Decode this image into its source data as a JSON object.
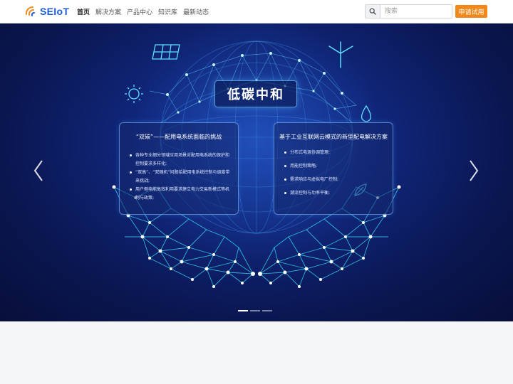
{
  "header": {
    "logo_text": "SEIoT",
    "nav": [
      {
        "label": "首页",
        "active": true
      },
      {
        "label": "解决方案",
        "active": false
      },
      {
        "label": "产品中心",
        "active": false
      },
      {
        "label": "知识库",
        "active": false
      },
      {
        "label": "最新动态",
        "active": false
      }
    ],
    "search": {
      "placeholder": "搜索",
      "value": ""
    },
    "cta_label": "申请试用"
  },
  "hero": {
    "headline": "低碳中和",
    "left_panel": {
      "title": "“双碳”——配用电系统面临的挑战",
      "items": [
        "各种专业细分领域应用场景对配用电系统的保护和控制要求多样化;",
        "“双高”、“双随机”问题给配用电系统控制与调度带来挑战;",
        "用户侧电能高效利用要求建立电力交易新模式等机制与政策;"
      ]
    },
    "right_panel": {
      "title": "基于工业互联网云模式的新型配电解决方案",
      "items": [
        "分布式电源协调管理;",
        "用能控制策略;",
        "需求响应与虚拟电厂控制;",
        "潮流控制与功率平衡;"
      ]
    },
    "slide_count": 3,
    "active_slide": 0
  },
  "colors": {
    "brand": "#1e5bd8",
    "accent": "#f0891a",
    "hero_dark": "#0a1650",
    "glow": "#37e6ff"
  }
}
